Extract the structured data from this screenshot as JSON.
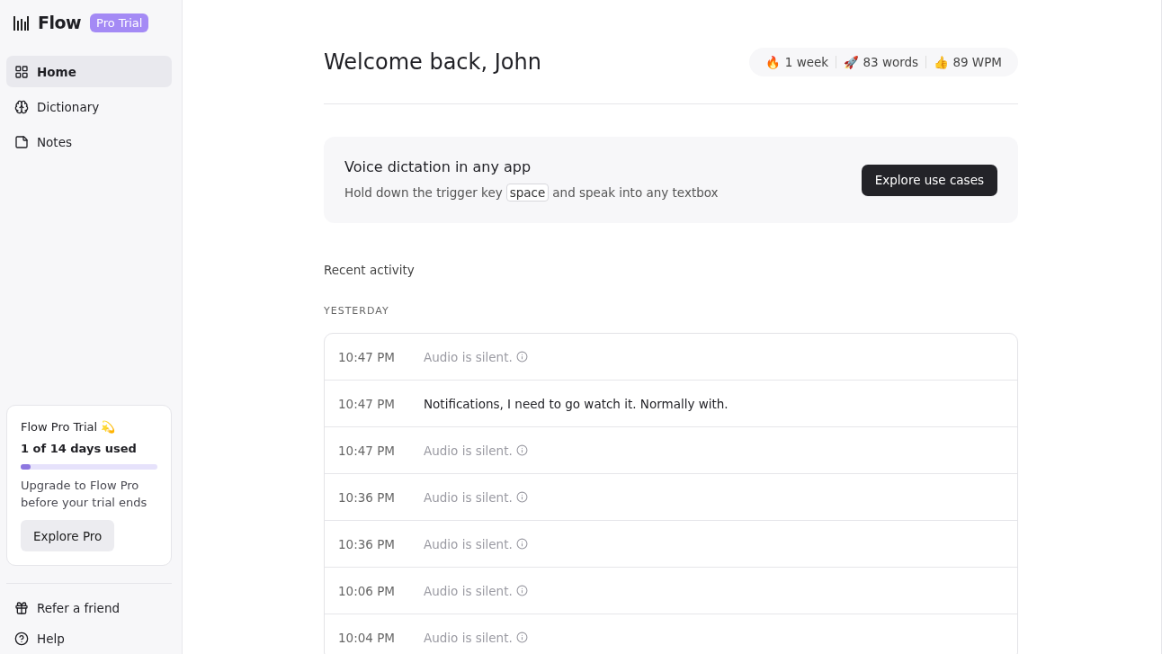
{
  "brand": {
    "name": "Flow",
    "badge": "Pro Trial"
  },
  "nav": [
    {
      "label": "Home",
      "selected": true
    },
    {
      "label": "Dictionary",
      "selected": false
    },
    {
      "label": "Notes",
      "selected": false
    }
  ],
  "trial_card": {
    "title": "Flow Pro Trial 💫",
    "usage": "1 of 14 days used",
    "level": 0.07,
    "message": "Upgrade to Flow Pro before your trial ends",
    "button": "Explore Pro"
  },
  "footer_nav": [
    {
      "label": "Refer a friend"
    },
    {
      "label": "Help"
    }
  ],
  "header": {
    "title": "Welcome back, John",
    "stats": [
      {
        "emoji": "🔥",
        "text": "1 week"
      },
      {
        "emoji": "🚀",
        "text": "83 words"
      },
      {
        "emoji": "👍",
        "text": "89 WPM"
      }
    ]
  },
  "promo": {
    "title": "Voice dictation in any app",
    "text_before": "Hold down the trigger key",
    "key": "space",
    "text_after": "and speak into any textbox",
    "button": "Explore use cases"
  },
  "activity": {
    "title": "Recent activity",
    "group": "YESTERDAY",
    "rows": [
      {
        "time": "10:47 PM",
        "text": "Audio is silent.",
        "kind": "silent"
      },
      {
        "time": "10:47 PM",
        "text": "Notifications, I need to go watch it. Normally with.",
        "kind": "text"
      },
      {
        "time": "10:47 PM",
        "text": "Audio is silent.",
        "kind": "silent"
      },
      {
        "time": "10:36 PM",
        "text": "Audio is silent.",
        "kind": "silent"
      },
      {
        "time": "10:36 PM",
        "text": "Audio is silent.",
        "kind": "silent"
      },
      {
        "time": "10:06 PM",
        "text": "Audio is silent.",
        "kind": "silent"
      },
      {
        "time": "10:04 PM",
        "text": "Audio is silent.",
        "kind": "silent"
      }
    ]
  }
}
